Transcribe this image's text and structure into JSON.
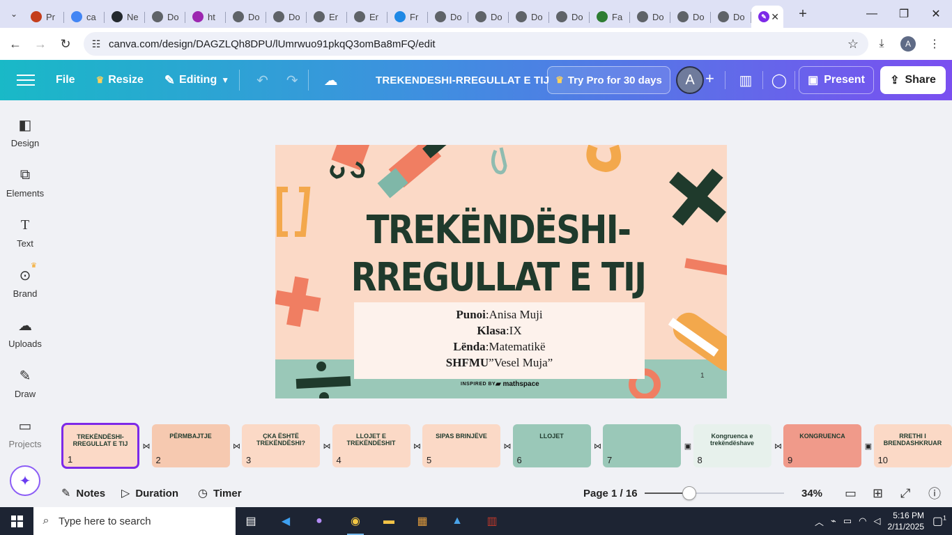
{
  "browser": {
    "tabs": [
      {
        "label": "Pr",
        "icon": "powerpoint-icon",
        "color": "#c43e1c"
      },
      {
        "label": "ca",
        "icon": "google-icon",
        "color": "#4285f4"
      },
      {
        "label": "Ne",
        "icon": "github-icon",
        "color": "#24292e"
      },
      {
        "label": "Do",
        "icon": "globe-icon",
        "color": "#5f6368"
      },
      {
        "label": "ht",
        "icon": "drive-icon",
        "color": "#9c27b0"
      },
      {
        "label": "Do",
        "icon": "globe-icon",
        "color": "#5f6368"
      },
      {
        "label": "Do",
        "icon": "globe-icon",
        "color": "#5f6368"
      },
      {
        "label": "Er",
        "icon": "globe-icon",
        "color": "#5f6368"
      },
      {
        "label": "Er",
        "icon": "globe-icon",
        "color": "#5f6368"
      },
      {
        "label": "Fr",
        "icon": "heart-icon",
        "color": "#1e88e5"
      },
      {
        "label": "Do",
        "icon": "globe-icon",
        "color": "#5f6368"
      },
      {
        "label": "Do",
        "icon": "globe-icon",
        "color": "#5f6368"
      },
      {
        "label": "Do",
        "icon": "globe-icon",
        "color": "#5f6368"
      },
      {
        "label": "Do",
        "icon": "globe-icon",
        "color": "#5f6368"
      },
      {
        "label": "Fa",
        "icon": "am-icon",
        "color": "#2e7d32"
      },
      {
        "label": "Do",
        "icon": "globe-icon",
        "color": "#5f6368"
      },
      {
        "label": "Do",
        "icon": "globe-icon",
        "color": "#5f6368"
      },
      {
        "label": "Do",
        "icon": "globe-icon",
        "color": "#5f6368"
      }
    ],
    "url": "canva.com/design/DAGZLQh8DPU/lUmrwuo91pkqQ3omBa8mFQ/edit",
    "profile_initial": "A"
  },
  "header": {
    "file": "File",
    "resize": "Resize",
    "editing": "Editing",
    "title": "TREKENDESHI-RREGULLAT E TIJ",
    "try_pro": "Try Pro for 30 days",
    "avatar": "A",
    "present": "Present",
    "share": "Share",
    "gradient": [
      "#19b9c7",
      "#3f8fe0",
      "#7a4ff0"
    ]
  },
  "sidebar": {
    "items": [
      {
        "label": "Design",
        "icon": "design-icon"
      },
      {
        "label": "Elements",
        "icon": "elements-icon"
      },
      {
        "label": "Text",
        "icon": "text-icon"
      },
      {
        "label": "Brand",
        "icon": "brand-icon"
      },
      {
        "label": "Uploads",
        "icon": "uploads-icon"
      },
      {
        "label": "Draw",
        "icon": "draw-icon"
      },
      {
        "label": "Projects",
        "icon": "projects-icon"
      }
    ]
  },
  "slide": {
    "title_line1": "TREKËNDËSHI-",
    "title_line2": "RREGULLAT E TIJ",
    "info": [
      {
        "key": "Punoi",
        "value": ":Anisa Muji"
      },
      {
        "key": "Klasa",
        "value": ":IX"
      },
      {
        "key": "Lënda",
        "value": ":Matematikë"
      },
      {
        "key": "SHFMU",
        "value": "”Vesel Muja”"
      }
    ],
    "inspired": "INSPIRED BY",
    "brand": "mathspace",
    "page_number": "1"
  },
  "filmstrip": {
    "thumbs": [
      {
        "num": "1",
        "title": "TREKËNDËSHI-RREGULLAT E TIJ",
        "bg": "#fbd9c6"
      },
      {
        "num": "2",
        "title": "PËRMBAJTJE",
        "bg": "#f6c9b0"
      },
      {
        "num": "3",
        "title": "ÇKA ËSHTË TREKËNDËSHI?",
        "bg": "#fbd9c6"
      },
      {
        "num": "4",
        "title": "LLOJET E TREKËNDËSHIT",
        "bg": "#fbd9c6"
      },
      {
        "num": "5",
        "title": "SIPAS BRINJËVE",
        "bg": "#fbd9c6"
      },
      {
        "num": "6",
        "title": "LLOJET",
        "bg": "#9ac8b8"
      },
      {
        "num": "7",
        "title": "",
        "bg": "#9ac8b8"
      },
      {
        "num": "8",
        "title": "Kongruenca e trekëndëshave",
        "bg": "#e7f1ec"
      },
      {
        "num": "9",
        "title": "KONGRUENCA",
        "bg": "#f09a8a"
      },
      {
        "num": "10",
        "title": "RRETHI I BRENDASHKRUAR",
        "bg": "#fbd9c6"
      }
    ]
  },
  "bottombar": {
    "notes": "Notes",
    "duration": "Duration",
    "timer": "Timer",
    "page_indicator": "Page 1 / 16",
    "zoom": "34%",
    "zoom_fraction": 0.32
  },
  "taskbar": {
    "search_placeholder": "Type here to search",
    "time": "5:16 PM",
    "date": "2/11/2025",
    "notifications": "1"
  }
}
